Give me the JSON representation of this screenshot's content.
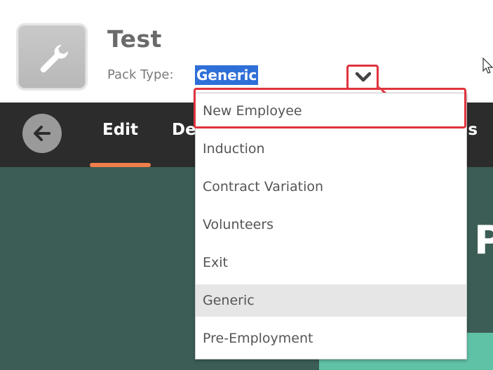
{
  "header": {
    "title": "Test",
    "pack_type_label": "Pack Type:",
    "pack_type_value": "Generic"
  },
  "nav": {
    "tabs": [
      {
        "label": "Edit"
      },
      {
        "label": "De"
      },
      {
        "label": "ns"
      }
    ]
  },
  "content": {
    "partial_heading": "P"
  },
  "dropdown": {
    "options": [
      {
        "label": "New Employee"
      },
      {
        "label": "Induction"
      },
      {
        "label": "Contract Variation"
      },
      {
        "label": "Volunteers"
      },
      {
        "label": "Exit"
      },
      {
        "label": "Generic"
      },
      {
        "label": "Pre-Employment"
      }
    ],
    "selected": "Generic",
    "highlighted": "New Employee"
  },
  "colors": {
    "accent_red": "#e0343e",
    "selection_blue": "#2f6fd8",
    "tab_underline": "#f07f4a",
    "navbar": "#2c2c2c",
    "content_bg": "#3b5d55",
    "teal": "#5fc1a6"
  },
  "icons": {
    "app": "wrench-icon",
    "back": "arrow-left-icon",
    "dropdown": "chevron-down-icon",
    "annotation": "arrow-pointer-icon",
    "cursor": "mouse-cursor-icon"
  }
}
